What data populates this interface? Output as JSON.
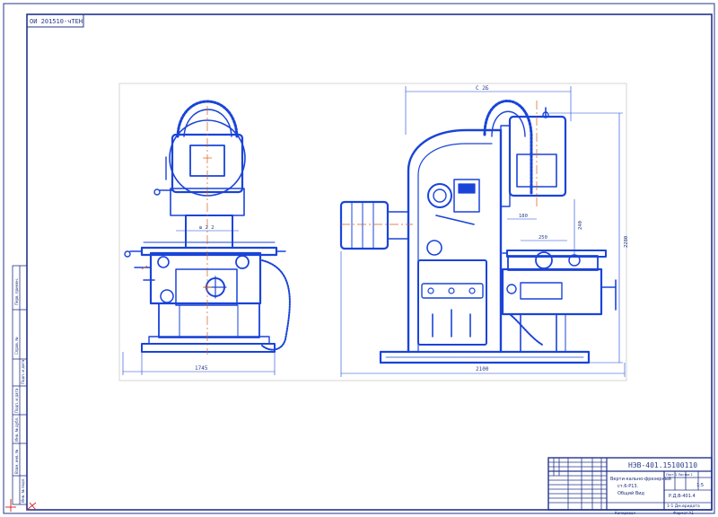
{
  "sheet": {
    "code_top_left": "ОИ 201510-чТЕН",
    "title_block": {
      "designation": "НЭВ-401.15100110",
      "name_lines": [
        "Верти-кально-фрезерный",
        "ст.6-Р13.",
        "Общий Вид"
      ],
      "scale": "1:5",
      "sheet_info": "Лист 1  Листов 1",
      "org_lines": [
        "Р.Д.В-401.4",
        "1-1  Дм.вридата"
      ],
      "footer_left": "Копировал",
      "footer_right": "Формат А1"
    },
    "side_stamp_labels": [
      "Перв. примен.",
      "Справ. №",
      "Подп. и дата",
      "Инв. № дубл.",
      "Взам. инв. №",
      "Подп. и дата",
      "Инв. № подл."
    ]
  },
  "front_view": {
    "dims": {
      "width": "1745",
      "table_width": "ш 2 2"
    }
  },
  "side_view": {
    "dims": {
      "top_width": "С 2Б",
      "bottom_width": "2100",
      "reach": "180",
      "stroke": "250",
      "height_small": "240",
      "height_overall": "2280"
    }
  },
  "colors": {
    "line": "#1a44d8",
    "border": "#24348c",
    "ink": "#2a3d88"
  }
}
